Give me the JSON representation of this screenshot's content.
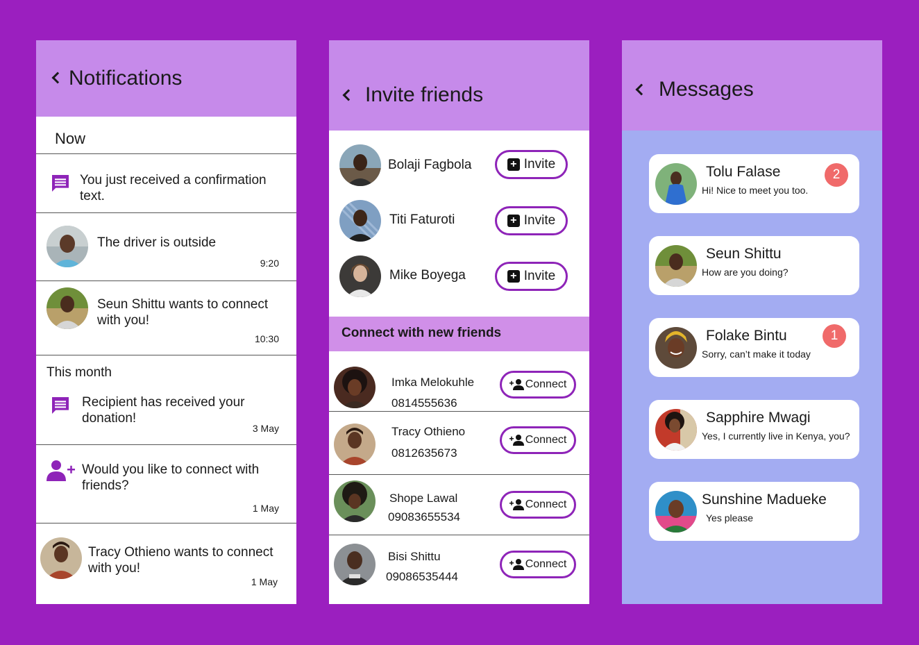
{
  "notifications": {
    "title": "Notifications",
    "section_now": "Now",
    "section_month": "This month",
    "items": [
      {
        "text": "You just received a confirmation text.",
        "time": ""
      },
      {
        "text": "The driver is outside",
        "time": "9:20"
      },
      {
        "text": "Seun Shittu wants to connect with you!",
        "time": "10:30"
      },
      {
        "text": "Recipient has received your donation!",
        "time": "3  May"
      },
      {
        "text": "Would you like to connect with friends?",
        "time": "1 May"
      },
      {
        "text": "Tracy Othieno wants to connect with you!",
        "time": "1 May"
      }
    ]
  },
  "invite": {
    "title": "Invite friends",
    "button_label": "Invite",
    "friends": [
      {
        "name": "Bolaji Fagbola"
      },
      {
        "name": "Titi Faturoti"
      },
      {
        "name": "Mike Boyega"
      }
    ],
    "connect_header": "Connect with new friends",
    "connect_label": "Connect",
    "suggestions": [
      {
        "name": "Imka Melokuhle",
        "phone": "0814555636"
      },
      {
        "name": "Tracy Othieno",
        "phone": "0812635673"
      },
      {
        "name": "Shope Lawal",
        "phone": "09083655534"
      },
      {
        "name": "Bisi Shittu",
        "phone": "09086535444"
      }
    ]
  },
  "messages": {
    "title": "Messages",
    "threads": [
      {
        "name": "Tolu Falase",
        "preview": "Hi! Nice to meet you too.",
        "unread": "2"
      },
      {
        "name": "Seun Shittu",
        "preview": "How are you doing?",
        "unread": ""
      },
      {
        "name": "Folake Bintu",
        "preview": "Sorry, can’t make it today",
        "unread": "1"
      },
      {
        "name": "Sapphire Mwagi",
        "preview": "Yes, I currently live in Kenya, you?",
        "unread": ""
      },
      {
        "name": "Sunshine Madueke",
        "preview": "Yes please",
        "unread": ""
      }
    ]
  },
  "colors": {
    "background": "#9b1fbf",
    "header": "#c68aea",
    "accent_border": "#8e24b8",
    "icon_purple": "#8e24b8",
    "messages_bg": "#a3acf2",
    "badge": "#f06a6a"
  }
}
